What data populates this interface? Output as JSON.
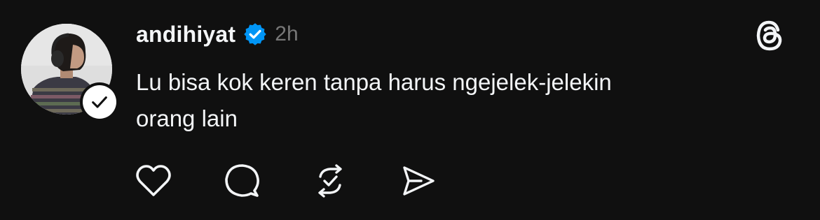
{
  "post": {
    "username": "andihiyat",
    "timestamp": "2h",
    "text": "Lu bisa kok keren tanpa harus ngejelek-jelekin\norang lain",
    "verified": true
  },
  "icons": {
    "avatar": "profile-photo",
    "follow_badge": "check-icon",
    "verified": "verified-badge-icon",
    "app_logo": "threads-logo-icon",
    "actions": [
      "heart-icon",
      "comment-icon",
      "repost-icon",
      "share-icon"
    ]
  },
  "colors": {
    "background": "#101010",
    "text": "#f3f5f7",
    "muted": "#777777",
    "verified": "#0095f6"
  }
}
